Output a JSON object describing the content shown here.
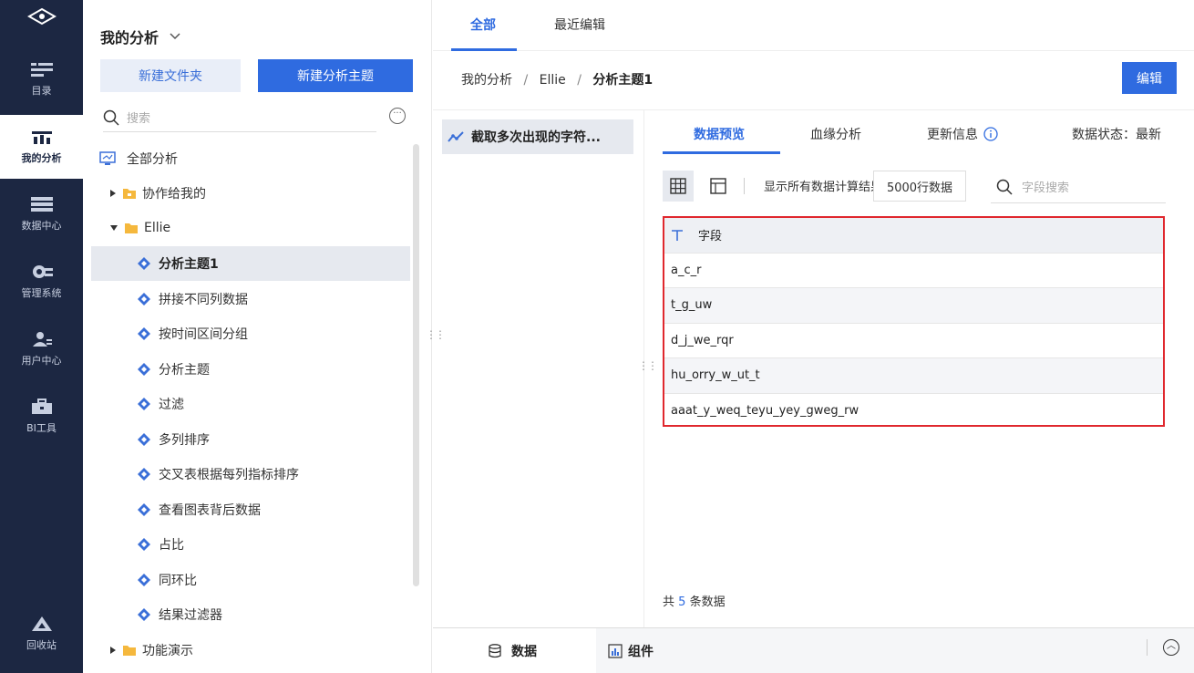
{
  "rail": {
    "items": [
      {
        "label": "目录",
        "icon": "list-icon"
      },
      {
        "label": "我的分析",
        "icon": "chart-icon",
        "active": true
      },
      {
        "label": "数据中心",
        "icon": "database-icon"
      },
      {
        "label": "管理系统",
        "icon": "gear-icon"
      },
      {
        "label": "用户中心",
        "icon": "user-icon"
      },
      {
        "label": "BI工具",
        "icon": "toolbox-icon"
      }
    ],
    "recycle": "回收站"
  },
  "tree": {
    "title": "我的分析",
    "new_folder": "新建文件夹",
    "new_theme": "新建分析主题",
    "search_placeholder": "搜索",
    "rows": [
      {
        "label": "全部分析",
        "icon": "monitor-icon"
      },
      {
        "label": "协作给我的",
        "icon": "folder-icon"
      },
      {
        "label": "Ellie",
        "icon": "folder-icon"
      },
      {
        "label": "分析主题1",
        "icon": "theme-icon",
        "selected": true
      },
      {
        "label": "拼接不同列数据",
        "icon": "theme-icon"
      },
      {
        "label": "按时间区间分组",
        "icon": "theme-icon"
      },
      {
        "label": "分析主题",
        "icon": "theme-icon"
      },
      {
        "label": "过滤",
        "icon": "theme-icon"
      },
      {
        "label": "多列排序",
        "icon": "theme-icon"
      },
      {
        "label": "交叉表根据每列指标排序",
        "icon": "theme-icon"
      },
      {
        "label": "查看图表背后数据",
        "icon": "theme-icon"
      },
      {
        "label": "占比",
        "icon": "theme-icon"
      },
      {
        "label": "同环比",
        "icon": "theme-icon"
      },
      {
        "label": "结果过滤器",
        "icon": "theme-icon"
      },
      {
        "label": "功能演示",
        "icon": "folder-icon"
      }
    ]
  },
  "main": {
    "tabs": [
      "全部",
      "最近编辑"
    ],
    "breadcrumb": {
      "root": "我的分析",
      "sep": "/",
      "folder": "Ellie",
      "current": "分析主题1"
    },
    "edit": "编辑",
    "list_item": "截取多次出现的字符...",
    "data_tabs": [
      "数据预览",
      "血缘分析",
      "更新信息"
    ],
    "status": "数据状态：最新",
    "show_all": "显示所有数据计算结果的前",
    "row_count": "5000行数据",
    "field_search_placeholder": "字段搜索",
    "grid": {
      "header": "字段",
      "rows": [
        "a_c_r",
        "t_g_uw",
        "d_j_we_rqr",
        "hu_orry_w_ut_t",
        "aaat_y_weq_teyu_yey_gweg_rw"
      ]
    },
    "total_prefix": "共",
    "total_count": "5",
    "total_suffix": "条数据",
    "bottom_tabs": [
      "数据",
      "组件"
    ]
  },
  "colors": {
    "accent": "#2f6be0",
    "rail": "#1c2742",
    "highlight_border": "#e0282e"
  }
}
